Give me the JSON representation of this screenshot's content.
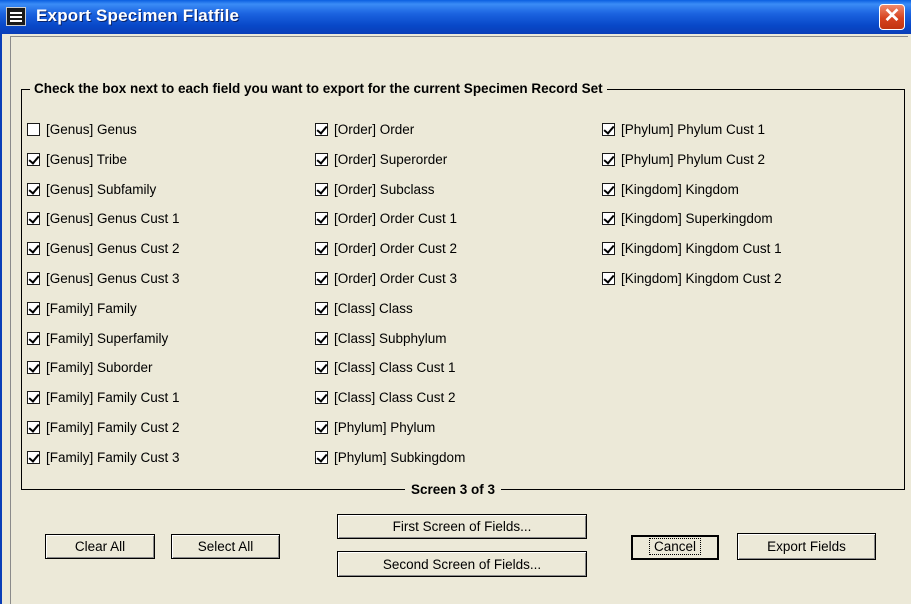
{
  "window": {
    "title": "Export Specimen Flatfile",
    "close_label": "✕"
  },
  "group": {
    "title": "Check the box next to each field you want to export for the current Specimen Record Set",
    "screen_label": "Screen 3 of 3"
  },
  "columns": [
    [
      {
        "label": "[Genus] Genus",
        "checked": false
      },
      {
        "label": "[Genus] Tribe",
        "checked": true
      },
      {
        "label": "[Genus] Subfamily",
        "checked": true
      },
      {
        "label": "[Genus] Genus Cust 1",
        "checked": true
      },
      {
        "label": "[Genus] Genus Cust 2",
        "checked": true
      },
      {
        "label": "[Genus] Genus Cust 3",
        "checked": true
      },
      {
        "label": "[Family] Family",
        "checked": true
      },
      {
        "label": "[Family] Superfamily",
        "checked": true
      },
      {
        "label": "[Family] Suborder",
        "checked": true
      },
      {
        "label": "[Family] Family Cust 1",
        "checked": true
      },
      {
        "label": "[Family] Family Cust 2",
        "checked": true
      },
      {
        "label": "[Family] Family Cust 3",
        "checked": true
      }
    ],
    [
      {
        "label": "[Order] Order",
        "checked": true
      },
      {
        "label": "[Order] Superorder",
        "checked": true
      },
      {
        "label": "[Order] Subclass",
        "checked": true
      },
      {
        "label": "[Order] Order Cust 1",
        "checked": true
      },
      {
        "label": "[Order] Order Cust 2",
        "checked": true
      },
      {
        "label": "[Order] Order Cust 3",
        "checked": true
      },
      {
        "label": "[Class] Class",
        "checked": true
      },
      {
        "label": "[Class] Subphylum",
        "checked": true
      },
      {
        "label": "[Class] Class Cust 1",
        "checked": true
      },
      {
        "label": "[Class] Class Cust 2",
        "checked": true
      },
      {
        "label": "[Phylum] Phylum",
        "checked": true
      },
      {
        "label": "[Phylum] Subkingdom",
        "checked": true
      }
    ],
    [
      {
        "label": "[Phylum] Phylum Cust 1",
        "checked": true
      },
      {
        "label": "[Phylum] Phylum Cust 2",
        "checked": true
      },
      {
        "label": "[Kingdom] Kingdom",
        "checked": true
      },
      {
        "label": "[Kingdom] Superkingdom",
        "checked": true
      },
      {
        "label": "[Kingdom] Kingdom Cust 1",
        "checked": true
      },
      {
        "label": "[Kingdom] Kingdom Cust 2",
        "checked": true
      }
    ]
  ],
  "buttons": {
    "clear_all": "Clear All",
    "select_all": "Select All",
    "first_screen": "First Screen of Fields...",
    "second_screen": "Second Screen of Fields...",
    "cancel": "Cancel",
    "export_fields": "Export Fields"
  }
}
